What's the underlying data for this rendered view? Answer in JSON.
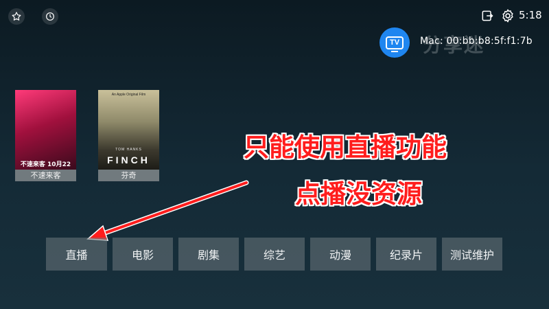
{
  "header": {
    "favorites_icon": "star-icon",
    "history_icon": "clock-icon",
    "exit_icon": "exit-icon",
    "settings_icon": "gear-icon",
    "time": "5:18",
    "logo_text": "TV",
    "mac_label": "Mac: 00:bb:b8:5f:f1:7b",
    "watermark": "分享迷"
  },
  "posters": [
    {
      "title": "不速来客",
      "art_text": "不速来客 10月22日"
    },
    {
      "title": "芬奇",
      "art_text": "FINCH",
      "art_top": "An Apple Original Film",
      "art_actor": "TOM HANKS"
    }
  ],
  "annotation": {
    "line1": "只能使用直播功能",
    "line2": "点播没资源",
    "color": "#ff1d1d"
  },
  "nav": [
    {
      "label": "直播"
    },
    {
      "label": "电影"
    },
    {
      "label": "剧集"
    },
    {
      "label": "综艺"
    },
    {
      "label": "动漫"
    },
    {
      "label": "纪录片"
    },
    {
      "label": "测试维护"
    }
  ]
}
